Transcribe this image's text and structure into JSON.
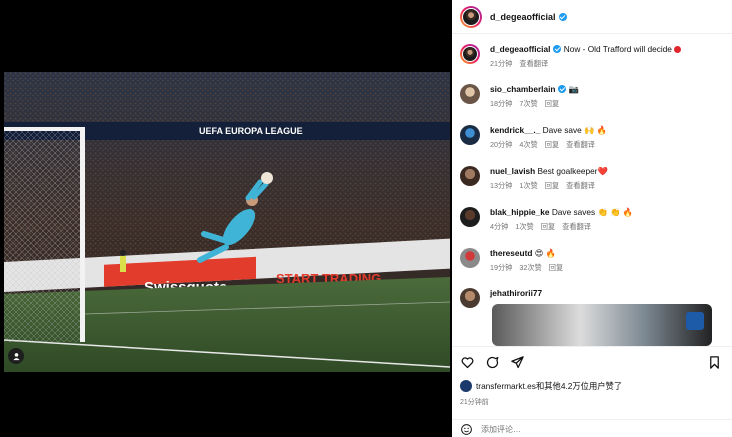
{
  "header": {
    "username": "d_degeaofficial"
  },
  "photo": {
    "banner_top": "UEFA EUROPA LEAGUE",
    "ad_brand": "Swissquote",
    "ad_cta": "START TRADING"
  },
  "caption": {
    "username": "d_degeaofficial",
    "text": "Now - Old Trafford will decide",
    "time": "21分钟",
    "translate": "查看翻译"
  },
  "comments": [
    {
      "username": "sio_chamberlain",
      "text": "📷",
      "time": "18分钟",
      "likes": "7次赞",
      "reply": "回复",
      "translate": ""
    },
    {
      "username": "kendrick__._",
      "text": "Dave save 🙌 🔥",
      "time": "20分钟",
      "likes": "4次赞",
      "reply": "回复",
      "translate": "查看翻译"
    },
    {
      "username": "nuel_lavish",
      "text": "Best goalkeeper❤️",
      "time": "13分钟",
      "likes": "1次赞",
      "reply": "回复",
      "translate": "查看翻译"
    },
    {
      "username": "blak_hippie_ke",
      "text": "Dave saves 👏 👏 🔥",
      "time": "4分钟",
      "likes": "1次赞",
      "reply": "回复",
      "translate": "查看翻译"
    },
    {
      "username": "thereseutd",
      "text": "😍 🔥",
      "time": "19分钟",
      "likes": "32次赞",
      "reply": "回复",
      "translate": ""
    },
    {
      "username": "jehathirorii77",
      "text": "",
      "time": "",
      "likes": "",
      "reply": "",
      "translate": ""
    }
  ],
  "footer": {
    "liked_by": "transfermarkt.es和其他4.2万位用户赞了",
    "time": "21分钟前",
    "comment_placeholder": "添加评论…"
  }
}
